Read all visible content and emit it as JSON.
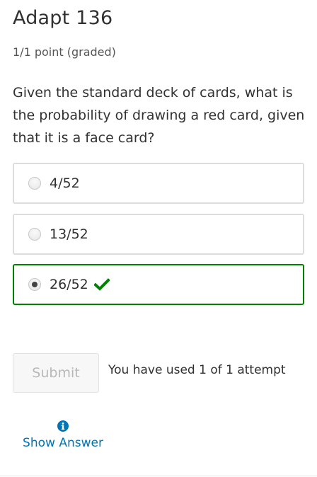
{
  "problem": {
    "title": "Adapt 136",
    "progress": "1/1 point (graded)",
    "question": "Given the standard deck of cards, what is the probability of drawing a red card, given that it is a face card?"
  },
  "choices": [
    {
      "label": "4/52",
      "selected": false,
      "correct": false
    },
    {
      "label": "13/52",
      "selected": false,
      "correct": false
    },
    {
      "label": "26/52",
      "selected": true,
      "correct": true
    }
  ],
  "actions": {
    "submit_label": "Submit",
    "attempts_text": "You have used 1 of 1 attempt",
    "show_answer_label": "Show Answer"
  },
  "colors": {
    "correct_green": "#008100",
    "link_blue": "#0075b4",
    "border_gray": "#dddddd",
    "disabled_text": "#b8b8b8"
  },
  "icons": {
    "correct": "checkmark-icon",
    "show_answer": "info-icon"
  }
}
